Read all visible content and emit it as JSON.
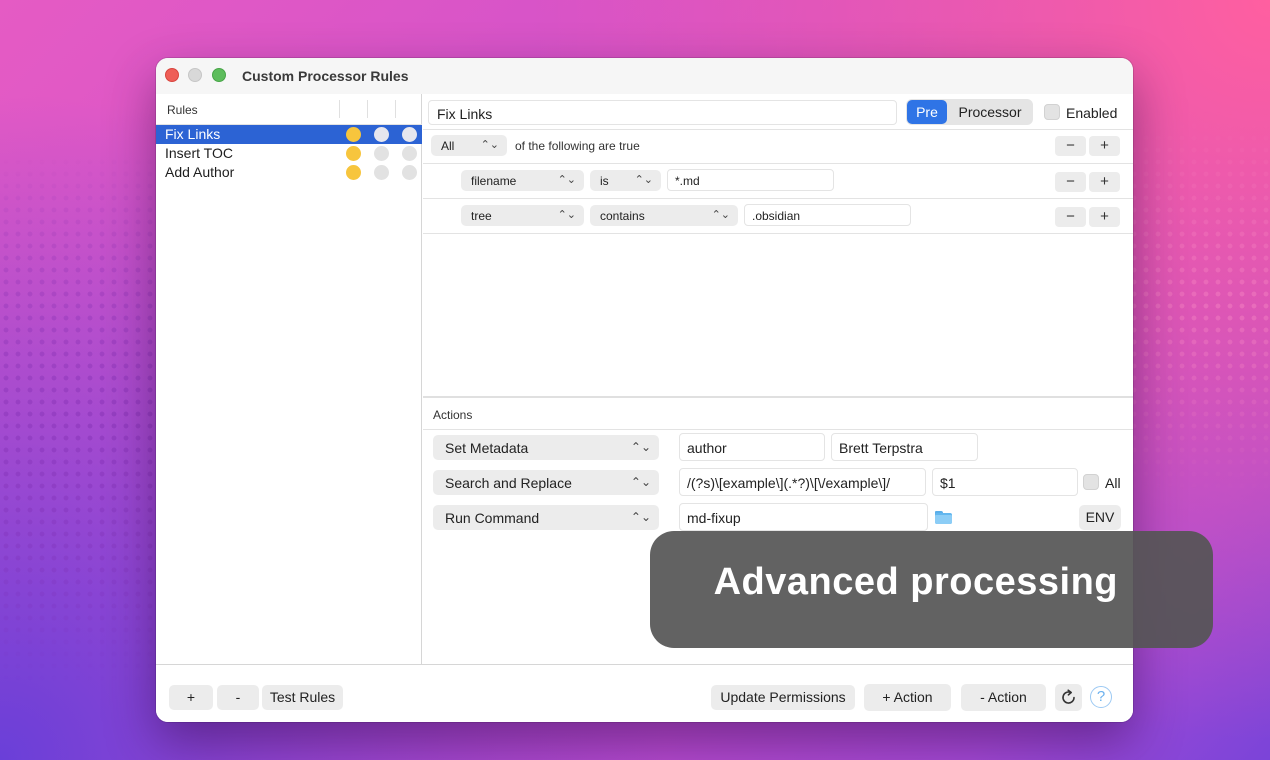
{
  "window": {
    "title": "Custom Processor Rules"
  },
  "sidebar": {
    "header": "Rules",
    "rules": [
      {
        "name": "Fix Links",
        "selected": true,
        "indicators": [
          "on",
          "off",
          "off"
        ]
      },
      {
        "name": "Insert TOC",
        "selected": false,
        "indicators": [
          "on",
          "off",
          "off"
        ]
      },
      {
        "name": "Add Author",
        "selected": false,
        "indicators": [
          "on",
          "off",
          "off"
        ]
      }
    ]
  },
  "editor": {
    "rule_name": "Fix Links",
    "mode": {
      "pre": "Pre",
      "processor": "Processor",
      "selected": "Pre"
    },
    "enabled_label": "Enabled",
    "enabled": false,
    "match": {
      "quantifier": "All",
      "suffix": "of the following are true"
    },
    "conditions": [
      {
        "field": "filename",
        "operator": "is",
        "value": "*.md"
      },
      {
        "field": "tree",
        "operator": "contains",
        "value": ".obsidian"
      }
    ],
    "minus": "−",
    "plus": "+"
  },
  "actions": {
    "label": "Actions",
    "rows": [
      {
        "type": "Set Metadata",
        "arg1": "author",
        "arg2": "Brett Terpstra"
      },
      {
        "type": "Search and Replace",
        "arg1": "/(?s)\\[example\\](.*?)\\[\\/example\\]/",
        "arg2": "$1",
        "all_label": "All"
      },
      {
        "type": "Run Command",
        "arg1": "md-fixup",
        "env_label": "ENV"
      }
    ]
  },
  "bottom": {
    "add": "+",
    "remove": "-",
    "test": "Test Rules",
    "update_permissions": "Update Permissions",
    "add_action": "+ Action",
    "remove_action": "- Action",
    "help": "?"
  },
  "overlay": {
    "text": "Advanced processing"
  },
  "colors": {
    "accent": "#2f74e6",
    "selection": "#2c63d4",
    "indicator_on": "#f7c53d"
  }
}
